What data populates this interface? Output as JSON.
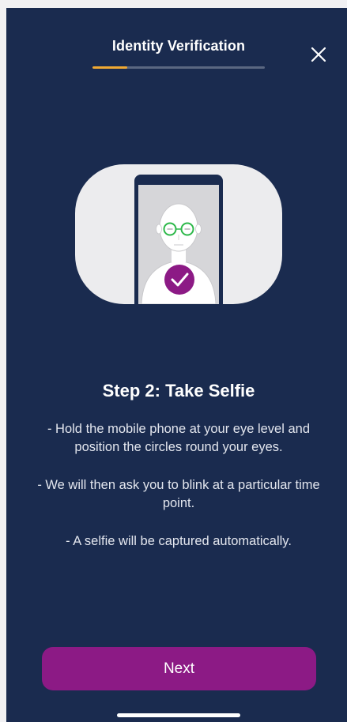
{
  "header": {
    "title": "Identity Verification",
    "progress": 0.2
  },
  "content": {
    "step_title": "Step 2: Take Selfie",
    "instructions": [
      "- Hold the mobile phone at your eye level and position the circles round your eyes.",
      "- We will then ask you to blink at a particular time point.",
      "- A selfie will be captured automatically."
    ]
  },
  "footer": {
    "next_label": "Next"
  },
  "icons": {
    "close": "close-icon",
    "check": "checkmark-icon"
  },
  "colors": {
    "background": "#1a2b4f",
    "accent": "#8c1a85",
    "progress": "#f0a933",
    "eye_circle": "#2db84a"
  }
}
